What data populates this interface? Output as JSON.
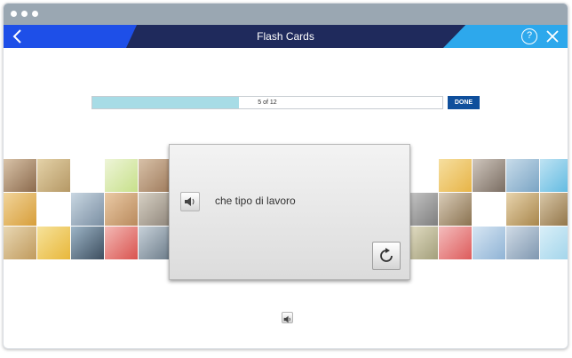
{
  "header": {
    "title": "Flash Cards",
    "help_label": "?"
  },
  "progress": {
    "text": "5 of 12",
    "current": 5,
    "total": 12,
    "fraction": 0.42
  },
  "done_label": "DONE",
  "card": {
    "phrase": "che tipo di lavoro"
  },
  "colors": {
    "brand_dark": "#1f2a5c",
    "brand_blue": "#1e4fe8",
    "brand_light": "#2da8ec",
    "progress_fill": "#a7dce6",
    "done_bg": "#0f4f9c"
  },
  "icons": [
    "back-arrow-icon",
    "help-icon",
    "close-icon",
    "speaker-icon",
    "flip-icon"
  ]
}
